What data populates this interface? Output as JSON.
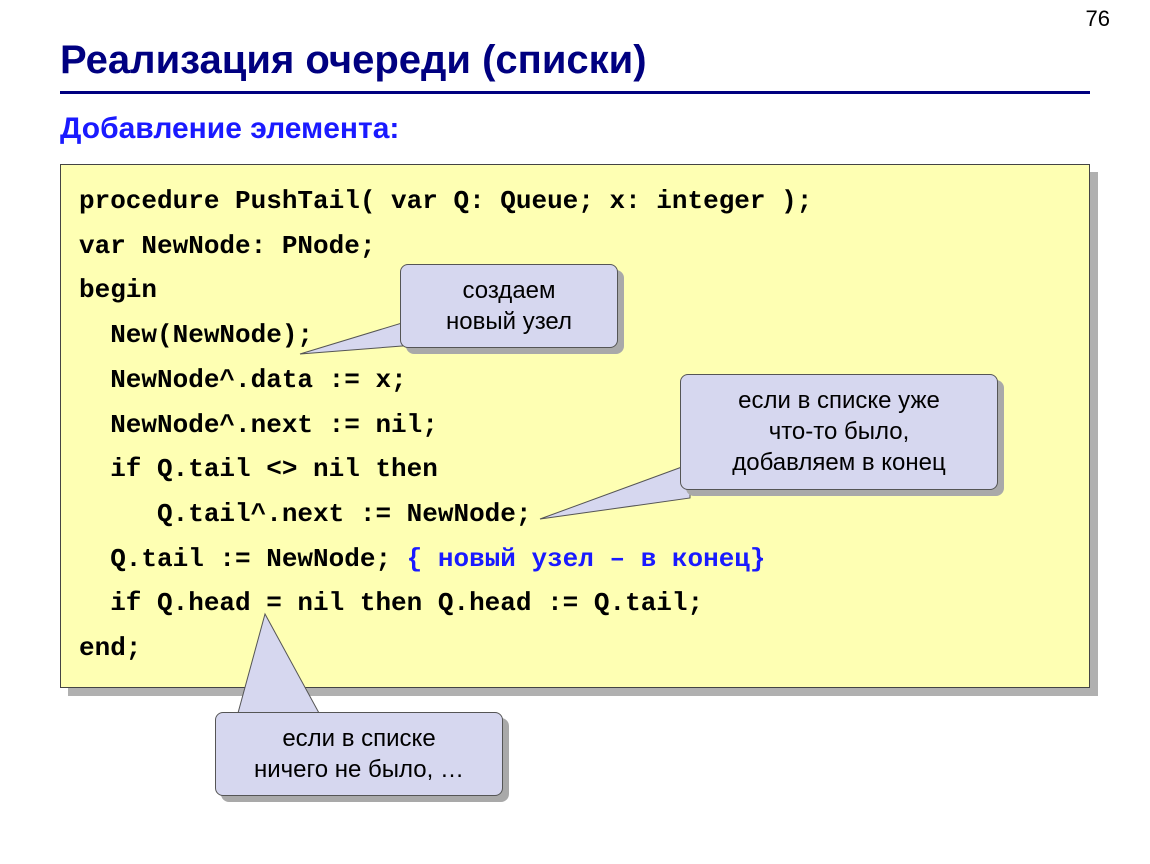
{
  "page_number": "76",
  "title": "Реализация очереди (списки)",
  "subtitle": "Добавление элемента:",
  "code": {
    "l1": "procedure PushTail( var Q: Queue; x: integer );",
    "l2": "var NewNode: PNode;",
    "l3": "begin",
    "l4": "  New(NewNode);",
    "l5": "  NewNode^.data := x;",
    "l6": "  NewNode^.next := nil;",
    "l7": "  if Q.tail <> nil then",
    "l8": "     Q.tail^.next := NewNode;",
    "l9a": "  Q.tail := NewNode; ",
    "l9b": "{ новый узел – в конец}",
    "l10": "  if Q.head = nil then Q.head := Q.tail;",
    "l11": "end;"
  },
  "callouts": {
    "c1_l1": "создаем",
    "c1_l2": "новый узел",
    "c2_l1": "если в списке уже",
    "c2_l2": "что-то было,",
    "c2_l3": "добавляем в конец",
    "c3_l1": "если в списке",
    "c3_l2": "ничего не было, …"
  }
}
